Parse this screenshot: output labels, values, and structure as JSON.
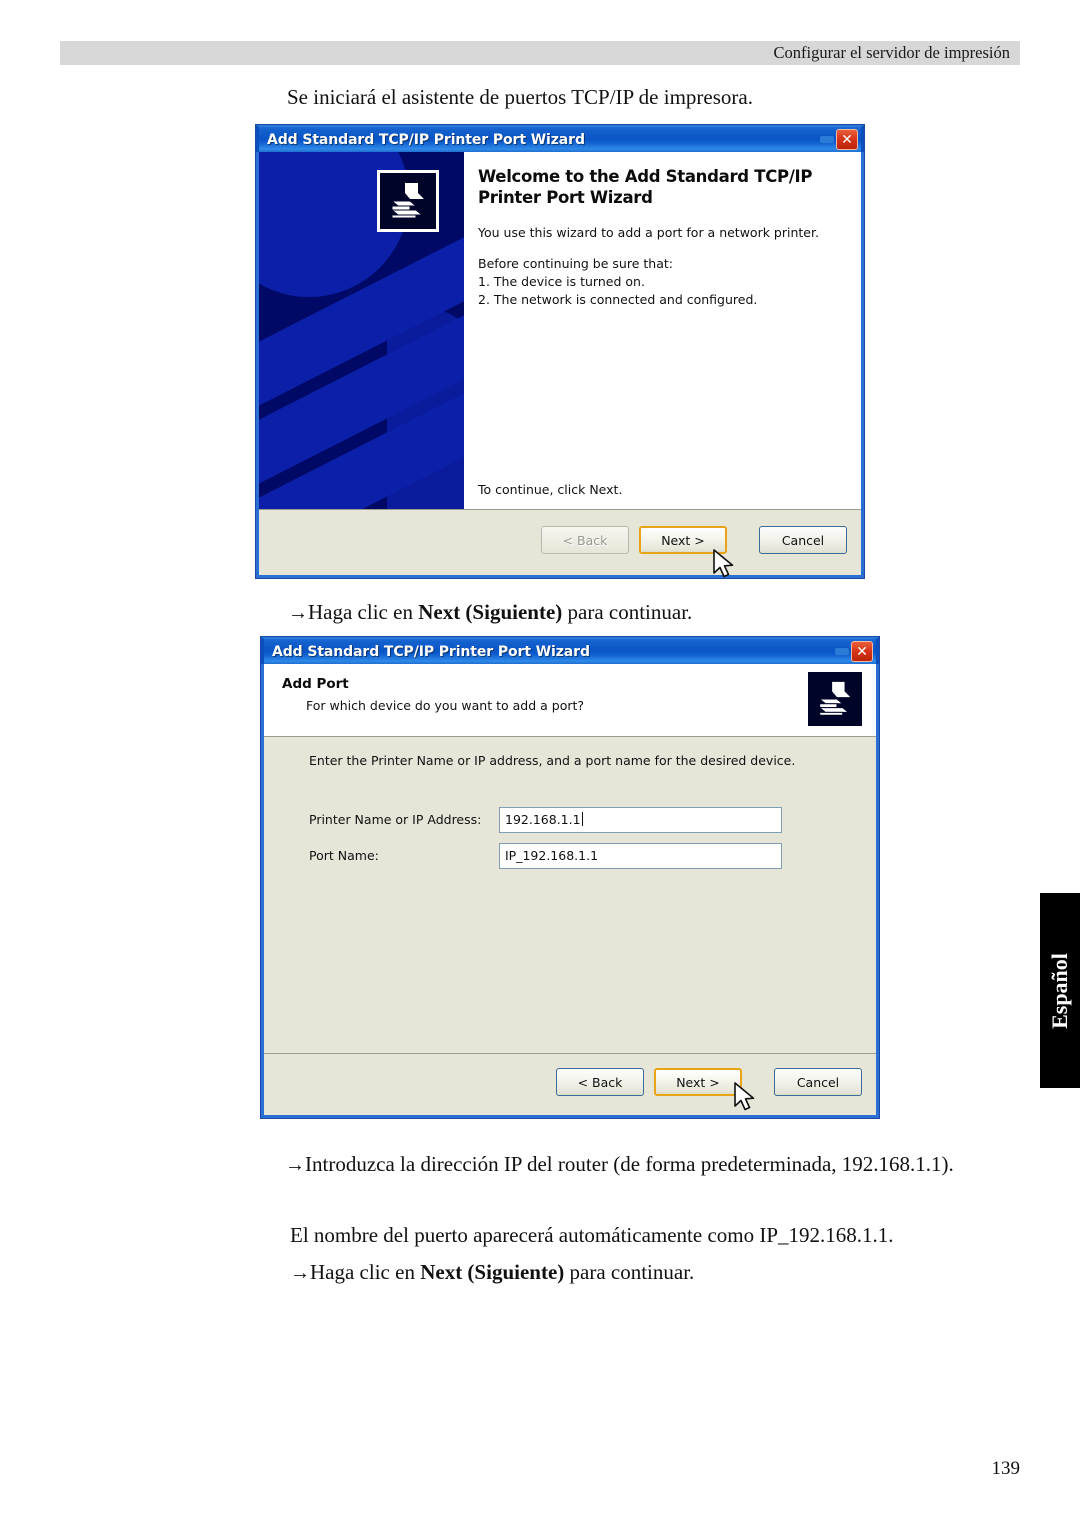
{
  "page": {
    "header_text": "Configurar el servidor de impresión",
    "number": "139",
    "side_tab_label": "Español"
  },
  "intro": {
    "line": "Se iniciará el asistente de puertos TCP/IP de impresora."
  },
  "step_after_first_dialog": {
    "arrow": "→",
    "prefix": "Haga clic en ",
    "bold": "Next (Siguiente)",
    "suffix": " para continuar."
  },
  "dialog1": {
    "title": "Add Standard TCP/IP Printer Port Wizard",
    "close_label": "✕",
    "heading": "Welcome to the Add Standard TCP/IP Printer Port Wizard",
    "paragraph": "You use this wizard to add a port for a network printer.",
    "before_label": "Before continuing be sure that:",
    "list": [
      "1.  The device is turned on.",
      "2.  The network is connected and configured."
    ],
    "continue_text": "To continue, click Next.",
    "buttons": {
      "back": "< Back",
      "next": "Next >",
      "cancel": "Cancel"
    }
  },
  "dialog2": {
    "title": "Add Standard TCP/IP Printer Port Wizard",
    "close_label": "✕",
    "head_title": "Add Port",
    "head_sub": "For which device do you want to add a port?",
    "intro": "Enter the Printer Name or IP address, and a port name for the desired device.",
    "fields": [
      {
        "label": "Printer Name or IP Address:",
        "value": "192.168.1.1"
      },
      {
        "label": "Port Name:",
        "value": "IP_192.168.1.1"
      }
    ],
    "buttons": {
      "back": "< Back",
      "next": "Next >",
      "cancel": "Cancel"
    }
  },
  "body_text": {
    "p1_arrow": "→",
    "p1": "Introduzca la dirección IP del router (de forma predeterminada, 192.168.1.1).",
    "p2": "El nombre del puerto aparecerá automáticamente como IP_192.168.1.1.",
    "p3_arrow": "→",
    "p3_prefix": "Haga clic en ",
    "p3_bold": "Next (Siguiente)",
    "p3_suffix": " para continuar."
  },
  "colors": {
    "title_blue": "#0b55c6",
    "banner_navy": "#000a66",
    "banner_blue": "#0b1fa8",
    "dialog_face": "#e6e6d8",
    "default_btn_outline": "#e8a317",
    "close_red": "#d8361a",
    "header_band": "#d7d7d7"
  }
}
